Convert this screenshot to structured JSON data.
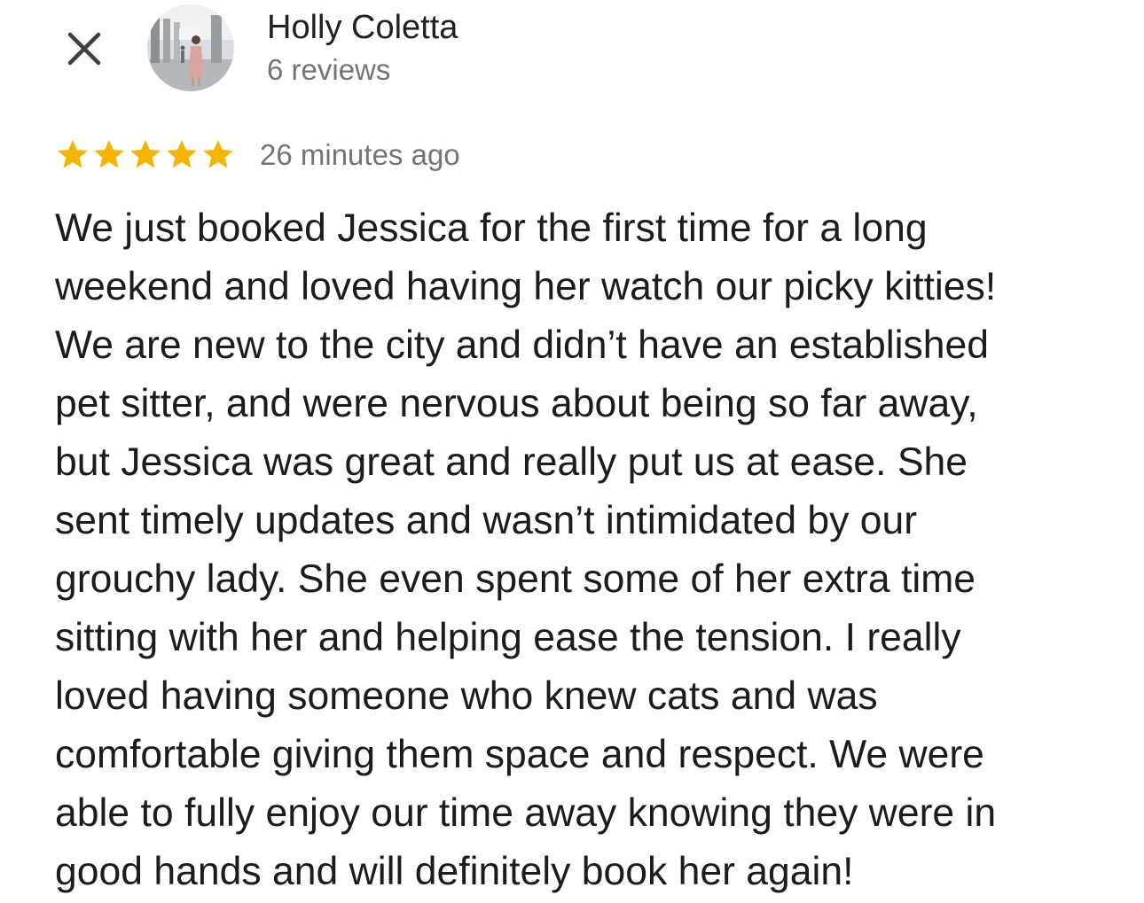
{
  "header": {
    "close_icon": "close-icon",
    "avatar_icon": "avatar",
    "author_name": "Holly Coletta",
    "review_count": "6 reviews"
  },
  "rating": {
    "stars": 5,
    "max_stars": 5,
    "star_color": "#f5b400",
    "time_ago": "26 minutes ago"
  },
  "review": {
    "lines": [
      "We just booked Jessica for the first time for a long",
      "weekend and loved having her watch our picky kitties!",
      "We are new to the city and didn’t have an established",
      "pet sitter, and were nervous about being so far away,",
      "but Jessica was great and really put us at ease. She",
      "sent timely updates and wasn’t intimidated by our",
      "grouchy lady. She even spent some of her extra time",
      "sitting with her and helping ease the tension. I really",
      "loved having someone who knew cats and was",
      "comfortable giving them space and respect. We were",
      "able to fully enjoy our time away knowing they were in",
      "good hands and will definitely book her again!"
    ]
  }
}
